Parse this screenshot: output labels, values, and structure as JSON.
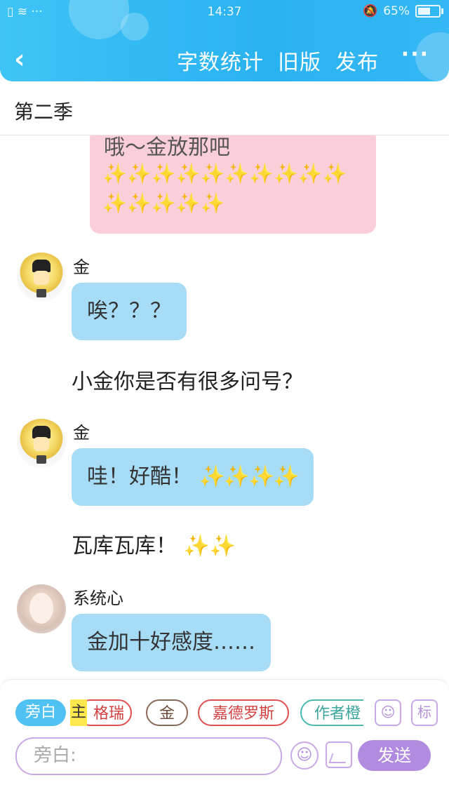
{
  "status_bar": {
    "time": "14:37",
    "battery": "65%",
    "battery_level": 0.65,
    "left_icons": "▯ ≋ ···"
  },
  "nav": {
    "back": "‹",
    "word_count": "字数统计",
    "old_version": "旧版",
    "publish": "发布",
    "more": "···"
  },
  "page_title": "第二季",
  "messages": {
    "pink_card": {
      "text": "哦～金放那吧",
      "sparkles": "✨✨✨✨✨✨✨✨✨✨✨✨✨✨✨"
    },
    "m1": {
      "name": "金",
      "text": "唉？？？"
    },
    "n1": {
      "text": "小金你是否有很多问号？"
    },
    "m2": {
      "name": "金",
      "text": "哇！好酷！",
      "sparkles": "✨✨✨✨"
    },
    "n2": {
      "text": "瓦库瓦库！",
      "sparkles": "✨✨"
    },
    "m3": {
      "name": "系统心",
      "text": "金加十好感度……"
    }
  },
  "composer": {
    "chips": {
      "narration": "旁白",
      "main_tag": "主",
      "gerui": "格瑞",
      "jin": "金",
      "jiade": "嘉德罗斯",
      "author": "作者橙"
    },
    "mark_label": "标",
    "input_placeholder": "旁白:",
    "send": "发送",
    "colors": {
      "accent": "#b18be0",
      "header": "#2ab2f0",
      "bubble": "#a6dcf5"
    }
  }
}
